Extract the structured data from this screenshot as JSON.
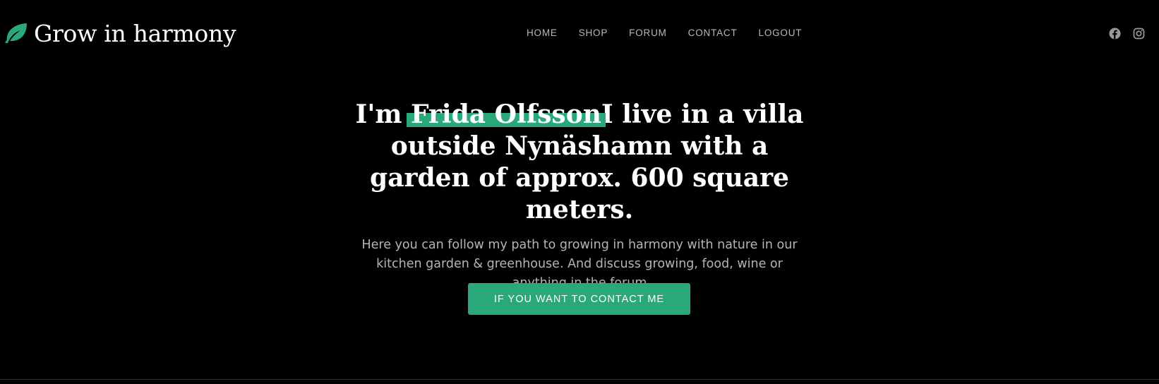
{
  "brand": {
    "name": "Grow in harmony",
    "icon": "leaf-icon",
    "icon_color": "#2aa87a"
  },
  "nav": {
    "items": [
      {
        "label": "HOME"
      },
      {
        "label": "SHOP"
      },
      {
        "label": "FORUM"
      },
      {
        "label": "CONTACT"
      },
      {
        "label": "LOGOUT"
      }
    ]
  },
  "social": {
    "items": [
      {
        "icon": "facebook-icon"
      },
      {
        "icon": "instagram-icon"
      }
    ],
    "color": "#9a9a9a"
  },
  "hero": {
    "headline_prefix": "I'm ",
    "headline_highlight": "Frida Olfsson ",
    "headline_rest": "I live in a villa outside Nynäshamn with a garden of approx. 600 square meters.",
    "subtext": "Here you can follow my path to growing in harmony with nature in our kitchen garden & greenhouse. And discuss growing, food, wine or anything in the forum",
    "cta_label": "IF YOU WANT TO CONTACT ME"
  },
  "colors": {
    "accent": "#2aa87a",
    "background": "#000000",
    "nav_text": "#b9b9b9"
  }
}
